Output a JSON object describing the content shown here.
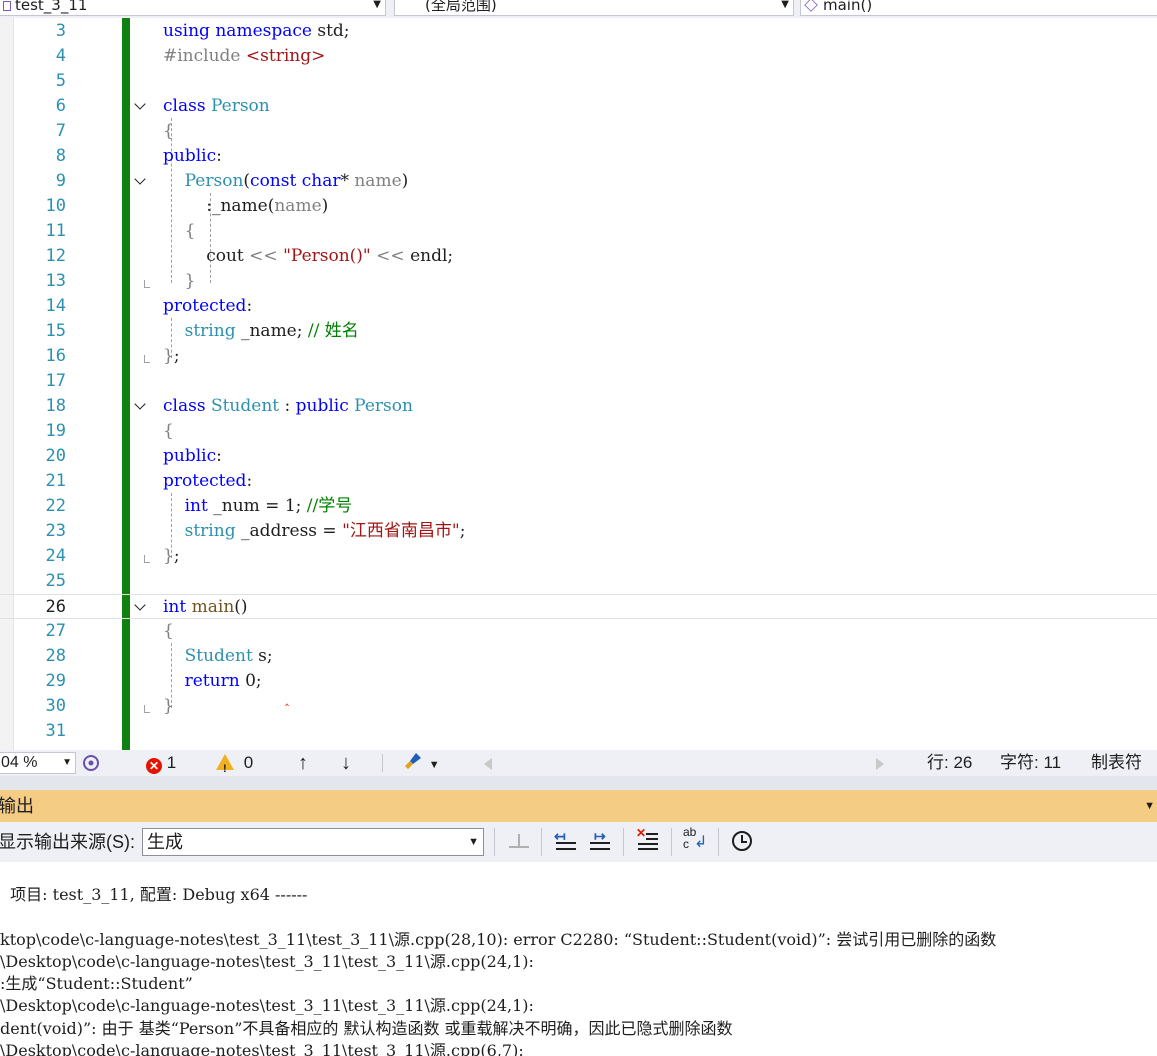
{
  "nav": {
    "project": "test_3_11",
    "scope": "(全局范围)",
    "member": "main()"
  },
  "editor": {
    "current_line": 26,
    "lines": [
      {
        "n": "3",
        "tokens": [
          [
            "kw",
            "using"
          ],
          [
            "p",
            " "
          ],
          [
            "kw",
            "namespace"
          ],
          [
            "p",
            " std;"
          ]
        ]
      },
      {
        "n": "4",
        "tokens": [
          [
            "nm",
            "#include "
          ],
          [
            "str",
            "<string>"
          ]
        ]
      },
      {
        "n": "5",
        "tokens": []
      },
      {
        "n": "6",
        "fold": true,
        "tokens": [
          [
            "kw",
            "class"
          ],
          [
            "p",
            " "
          ],
          [
            "ty",
            "Person"
          ]
        ]
      },
      {
        "n": "7",
        "tokens": [
          [
            "nm",
            "{"
          ]
        ]
      },
      {
        "n": "8",
        "tokens": [
          [
            "kw",
            "public"
          ],
          [
            "p",
            ":"
          ]
        ]
      },
      {
        "n": "9",
        "fold": true,
        "tokens": [
          [
            "p",
            "    "
          ],
          [
            "ty",
            "Person"
          ],
          [
            "p",
            "("
          ],
          [
            "kw",
            "const"
          ],
          [
            "p",
            " "
          ],
          [
            "kw",
            "char"
          ],
          [
            "p",
            "* "
          ],
          [
            "nm",
            "name"
          ],
          [
            "p",
            ")"
          ]
        ]
      },
      {
        "n": "10",
        "tokens": [
          [
            "p",
            "        :_name("
          ],
          [
            "nm",
            "name"
          ],
          [
            "p",
            ")"
          ]
        ]
      },
      {
        "n": "11",
        "tokens": [
          [
            "p",
            "    "
          ],
          [
            "nm",
            "{"
          ]
        ]
      },
      {
        "n": "12",
        "tokens": [
          [
            "p",
            "        cout "
          ],
          [
            "nm",
            "<<"
          ],
          [
            "p",
            " "
          ],
          [
            "str",
            "\"Person()\""
          ],
          [
            "p",
            " "
          ],
          [
            "nm",
            "<<"
          ],
          [
            "p",
            " endl;"
          ]
        ]
      },
      {
        "n": "13",
        "tokens": [
          [
            "p",
            "    "
          ],
          [
            "nm",
            "}"
          ]
        ]
      },
      {
        "n": "14",
        "tokens": [
          [
            "kw",
            "protected"
          ],
          [
            "p",
            ":"
          ]
        ]
      },
      {
        "n": "15",
        "tokens": [
          [
            "p",
            "    "
          ],
          [
            "ty",
            "string"
          ],
          [
            "p",
            " _name; "
          ],
          [
            "cm",
            "// 姓名"
          ]
        ]
      },
      {
        "n": "16",
        "tokens": [
          [
            "nm",
            "}"
          ],
          [
            "p",
            ";"
          ]
        ]
      },
      {
        "n": "17",
        "tokens": []
      },
      {
        "n": "18",
        "fold": true,
        "tokens": [
          [
            "kw",
            "class"
          ],
          [
            "p",
            " "
          ],
          [
            "ty",
            "Student"
          ],
          [
            "p",
            " : "
          ],
          [
            "kw",
            "public"
          ],
          [
            "p",
            " "
          ],
          [
            "ty",
            "Person"
          ]
        ]
      },
      {
        "n": "19",
        "tokens": [
          [
            "nm",
            "{"
          ]
        ]
      },
      {
        "n": "20",
        "tokens": [
          [
            "kw",
            "public"
          ],
          [
            "p",
            ":"
          ]
        ]
      },
      {
        "n": "21",
        "tokens": [
          [
            "kw",
            "protected"
          ],
          [
            "p",
            ":"
          ]
        ]
      },
      {
        "n": "22",
        "tokens": [
          [
            "p",
            "    "
          ],
          [
            "kw",
            "int"
          ],
          [
            "p",
            " _num = 1; "
          ],
          [
            "cm",
            "//学号"
          ]
        ]
      },
      {
        "n": "23",
        "tokens": [
          [
            "p",
            "    "
          ],
          [
            "ty",
            "string"
          ],
          [
            "p",
            " _address = "
          ],
          [
            "str",
            "\"江西省南昌市\""
          ],
          [
            "p",
            ";"
          ]
        ]
      },
      {
        "n": "24",
        "tokens": [
          [
            "nm",
            "}"
          ],
          [
            "p",
            ";"
          ]
        ]
      },
      {
        "n": "25",
        "tokens": []
      },
      {
        "n": "26",
        "fold": true,
        "tokens": [
          [
            "kw",
            "int"
          ],
          [
            "p",
            " "
          ],
          [
            "fn",
            "main"
          ],
          [
            "p",
            "()"
          ]
        ]
      },
      {
        "n": "27",
        "tokens": [
          [
            "nm",
            "{"
          ]
        ]
      },
      {
        "n": "28",
        "tokens": [
          [
            "p",
            "    "
          ],
          [
            "ty",
            "Student"
          ],
          [
            "p",
            " s;"
          ]
        ]
      },
      {
        "n": "29",
        "tokens": [
          [
            "p",
            "    "
          ],
          [
            "kw",
            "return"
          ],
          [
            "p",
            " 0;"
          ]
        ]
      },
      {
        "n": "30",
        "tokens": [
          [
            "nm",
            "}"
          ]
        ]
      },
      {
        "n": "31",
        "tokens": []
      }
    ]
  },
  "status": {
    "zoom": "04 %",
    "errors": "1",
    "warnings": "0",
    "line": "行: 26",
    "char": "字符: 11",
    "mode": "制表符"
  },
  "output": {
    "title": "输出",
    "source_label": "显示输出来源(S):",
    "source_value": "生成",
    "lines": [
      "  项目: test_3_11, 配置: Debug x64 ------",
      "",
      "ktop\\code\\c-language-notes\\test_3_11\\test_3_11\\源.cpp(28,10): error C2280: “Student::Student(void)”: 尝试引用已删除的函数",
      "\\Desktop\\code\\c-language-notes\\test_3_11\\test_3_11\\源.cpp(24,1):",
      ":生成“Student::Student”",
      "\\Desktop\\code\\c-language-notes\\test_3_11\\test_3_11\\源.cpp(24,1):",
      "dent(void)”: 由于 基类“Person”不具备相应的 默认构造函数 或重载解决不明确，因此已隐式删除函数",
      "\\Desktop\\code\\c-language-notes\\test_3_11\\test_3_11\\源.cpp(6,7):"
    ]
  },
  "colors": {
    "keyword": "#0000ff",
    "type": "#2b91af",
    "string": "#a31515",
    "comment": "#008000",
    "change_bar": "#108010",
    "output_header": "#f5cc84"
  }
}
